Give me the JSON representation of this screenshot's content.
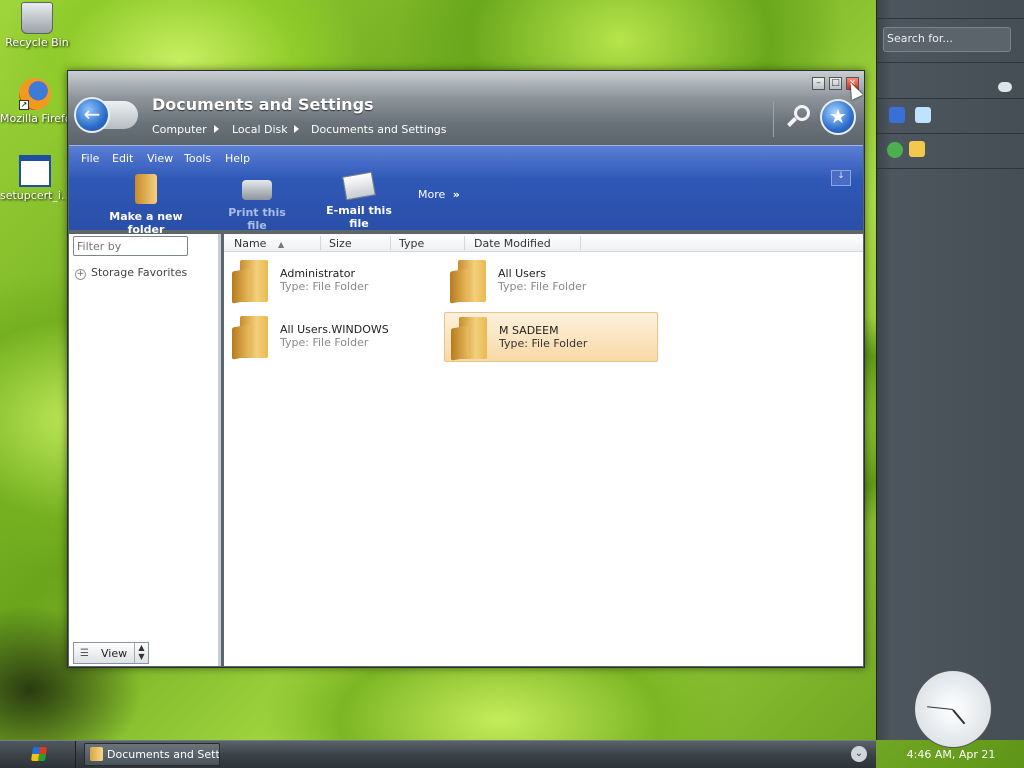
{
  "desktop": {
    "icons": [
      {
        "label": "Recycle Bin"
      },
      {
        "label": "Mozilla Firefox"
      },
      {
        "label": "setupcert_i..."
      }
    ]
  },
  "sidebar": {
    "search_placeholder": "Search for...",
    "clock_label": "4:46 AM, Apr 21"
  },
  "window": {
    "title": "Documents and Settings",
    "breadcrumb": [
      "Computer",
      "Local Disk",
      "Documents and Settings"
    ],
    "controls": {
      "minimize": "–",
      "maximize": "□",
      "close": "×"
    },
    "menu": [
      "File",
      "Edit",
      "View",
      "Tools",
      "Help"
    ],
    "toolbar": {
      "new_folder": "Make a new folder",
      "print": "Print this file",
      "email": "E-mail this file",
      "more": "More"
    },
    "left_pane": {
      "filter_placeholder": "Filter by",
      "storage_favorites": "Storage Favorites",
      "view_label": "View"
    },
    "columns": [
      "Name",
      "Size",
      "Type",
      "Date Modified"
    ],
    "items": [
      {
        "name": "Administrator",
        "type": "Type: File Folder",
        "selected": false
      },
      {
        "name": "All Users",
        "type": "Type: File Folder",
        "selected": false
      },
      {
        "name": "All Users.WINDOWS",
        "type": "Type: File Folder",
        "selected": false
      },
      {
        "name": "M SADEEM",
        "type": "Type: File Folder",
        "selected": true
      }
    ]
  },
  "taskbar": {
    "task_label": "Documents and Sett..."
  },
  "colors": {
    "toolbar_blue": "#2f58b6",
    "selection": "#f9d9a6",
    "titlebar": "#8e969c"
  }
}
